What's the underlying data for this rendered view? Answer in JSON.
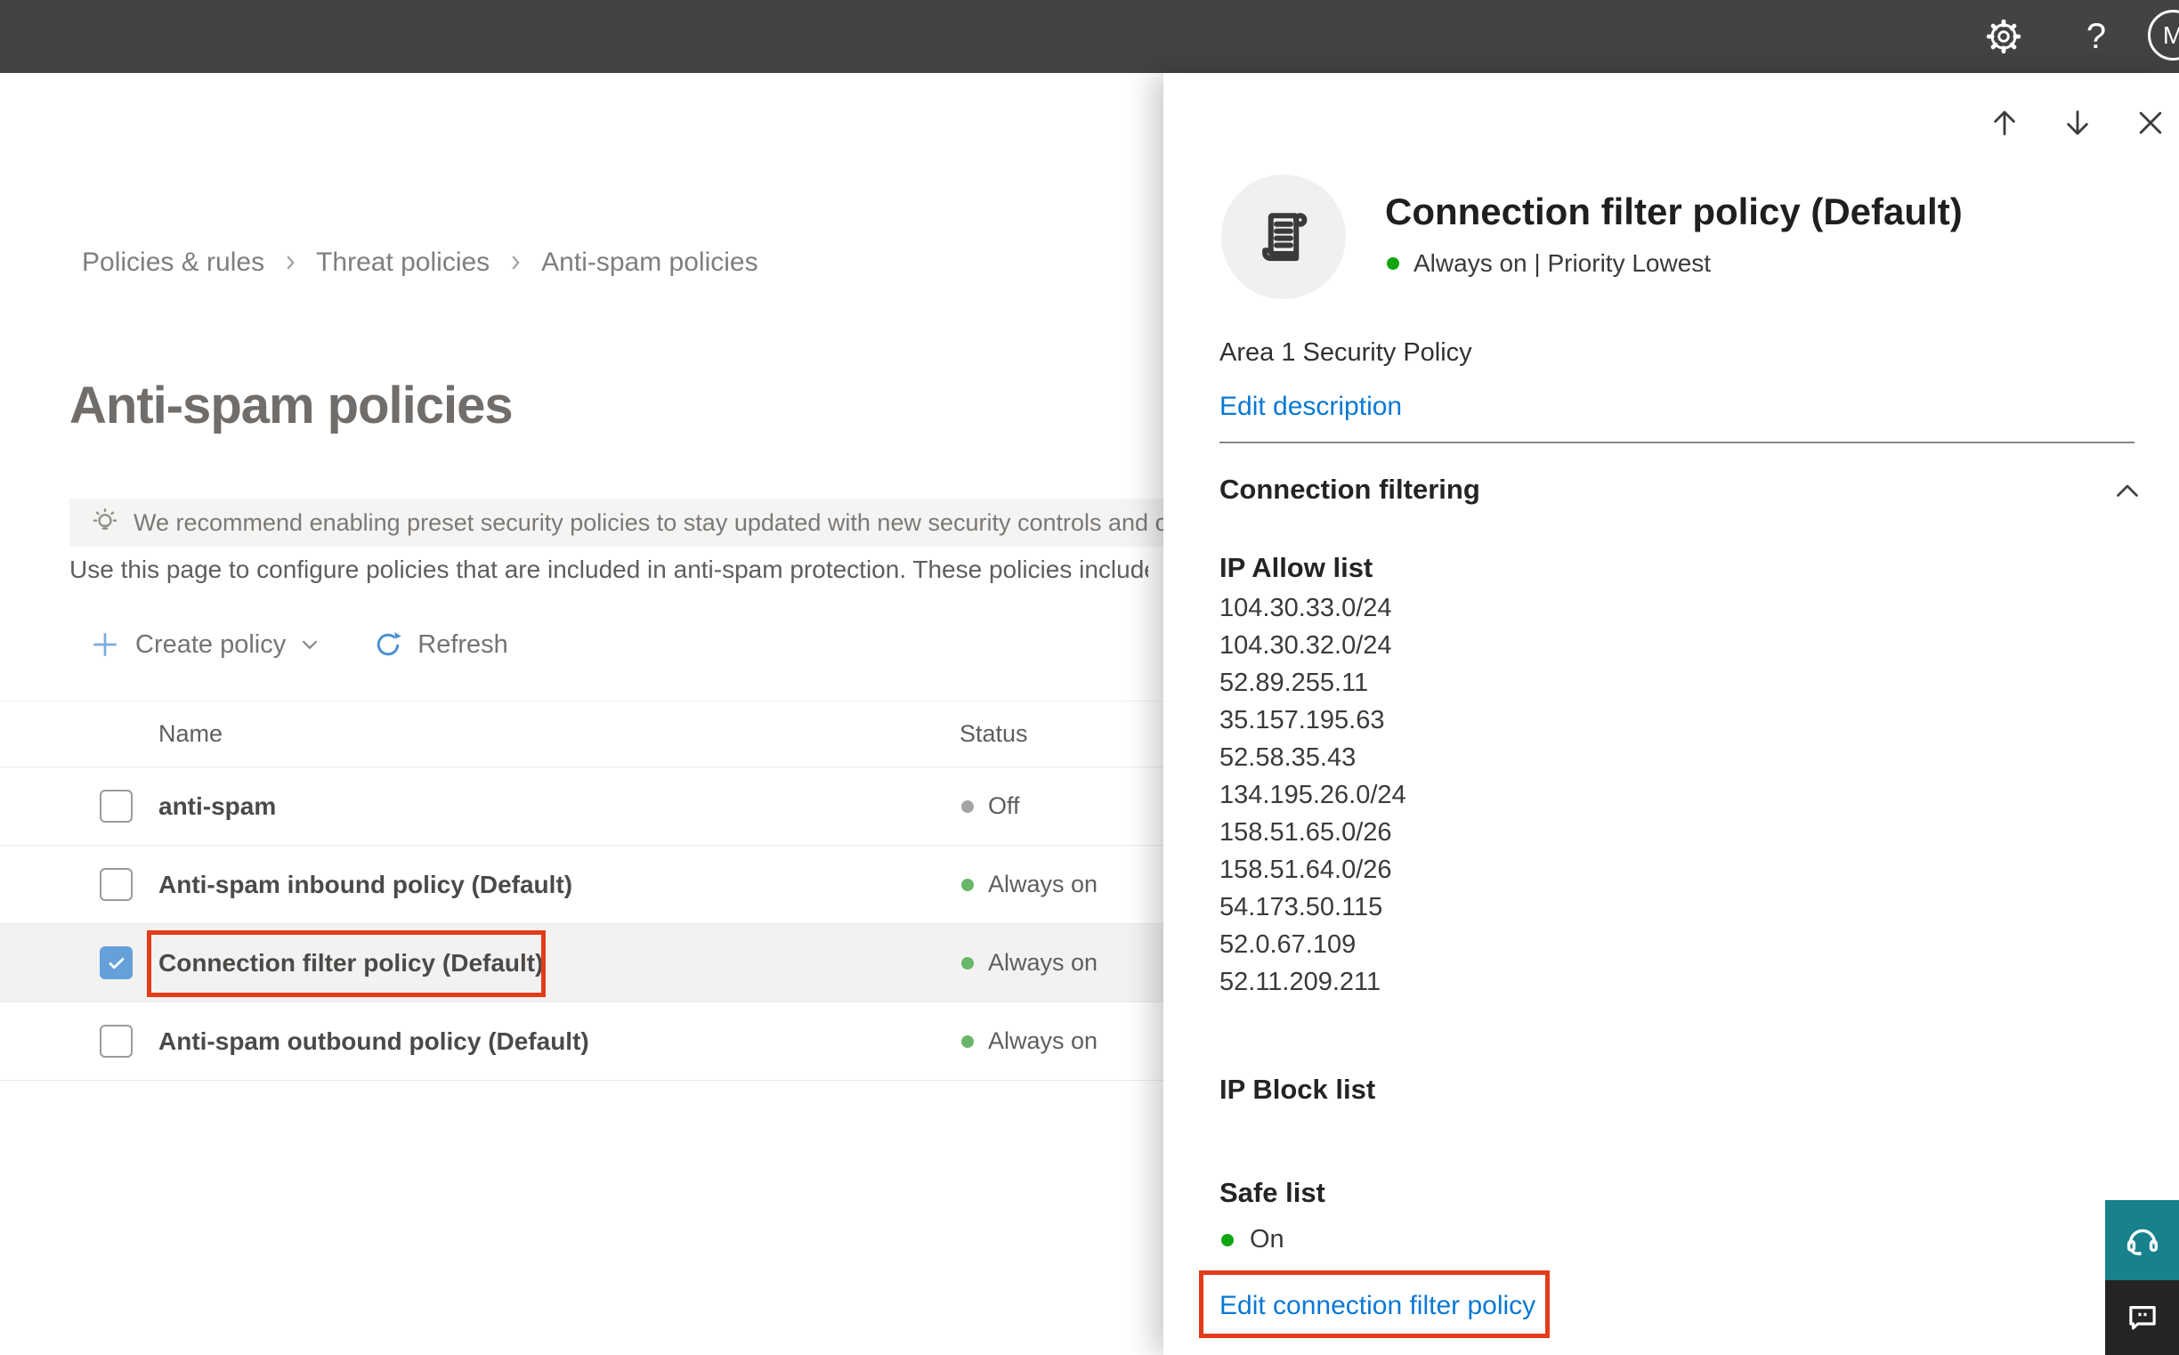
{
  "topbar": {
    "avatar_initial": "M",
    "help_glyph": "?"
  },
  "breadcrumb": {
    "items": [
      "Policies & rules",
      "Threat policies",
      "Anti-spam policies"
    ]
  },
  "page": {
    "title": "Anti-spam policies",
    "banner_text": "We recommend enabling preset security policies to stay updated with new security controls and our recomme",
    "description": "Use this page to configure policies that are included in anti-spam protection. These policies include"
  },
  "toolbar": {
    "create_policy_label": "Create policy",
    "refresh_label": "Refresh"
  },
  "table": {
    "columns": [
      "Name",
      "Status"
    ],
    "rows": [
      {
        "name": "anti-spam",
        "status": "Off",
        "checked": false,
        "selected": false,
        "annotated": false
      },
      {
        "name": "Anti-spam inbound policy (Default)",
        "status": "Always on",
        "checked": false,
        "selected": false,
        "annotated": false
      },
      {
        "name": "Connection filter policy (Default)",
        "status": "Always on",
        "checked": true,
        "selected": true,
        "annotated": true
      },
      {
        "name": "Anti-spam outbound policy (Default)",
        "status": "Always on",
        "checked": false,
        "selected": false,
        "annotated": false
      }
    ]
  },
  "panel": {
    "title": "Connection filter policy (Default)",
    "status_line": "Always on | Priority Lowest",
    "description": "Area 1 Security Policy",
    "edit_description_label": "Edit description",
    "section_title": "Connection filtering",
    "section_expanded": true,
    "ip_allow_label": "IP Allow list",
    "ip_allow_list": [
      "104.30.33.0/24",
      "104.30.32.0/24",
      "52.89.255.11",
      "35.157.195.63",
      "52.58.35.43",
      "134.195.26.0/24",
      "158.51.65.0/26",
      "158.51.64.0/26",
      "54.173.50.115",
      "52.0.67.109",
      "52.11.209.211"
    ],
    "ip_block_label": "IP Block list",
    "safe_list_label": "Safe list",
    "safe_list_status": "On",
    "edit_policy_label": "Edit connection filter policy"
  },
  "icons": {
    "topbar": [
      "settings-icon",
      "help-icon",
      "account-avatar"
    ],
    "panel_nav": [
      "arrow-up-icon",
      "arrow-down-icon",
      "close-icon"
    ],
    "misc": [
      "lightbulb-icon",
      "plus-icon",
      "chevron-down-icon",
      "refresh-icon",
      "chevron-up-icon",
      "scroll-policy-icon",
      "headset-icon",
      "feedback-chat-icon",
      "checkmark-icon",
      "breadcrumb-chevron-icon"
    ]
  },
  "colors": {
    "topbar_bg": "#454341",
    "link_blue": "#0a78d4",
    "annotation_red": "#e23c1a",
    "checkbox_blue": "#64a0da",
    "status_green_table": "#6ab76a",
    "status_green_bright": "#0fa60f",
    "status_gray": "#a6a4a2",
    "selected_row_bg": "#f3f2f1",
    "support_teal": "#17818c",
    "feedback_dark": "#252423"
  }
}
